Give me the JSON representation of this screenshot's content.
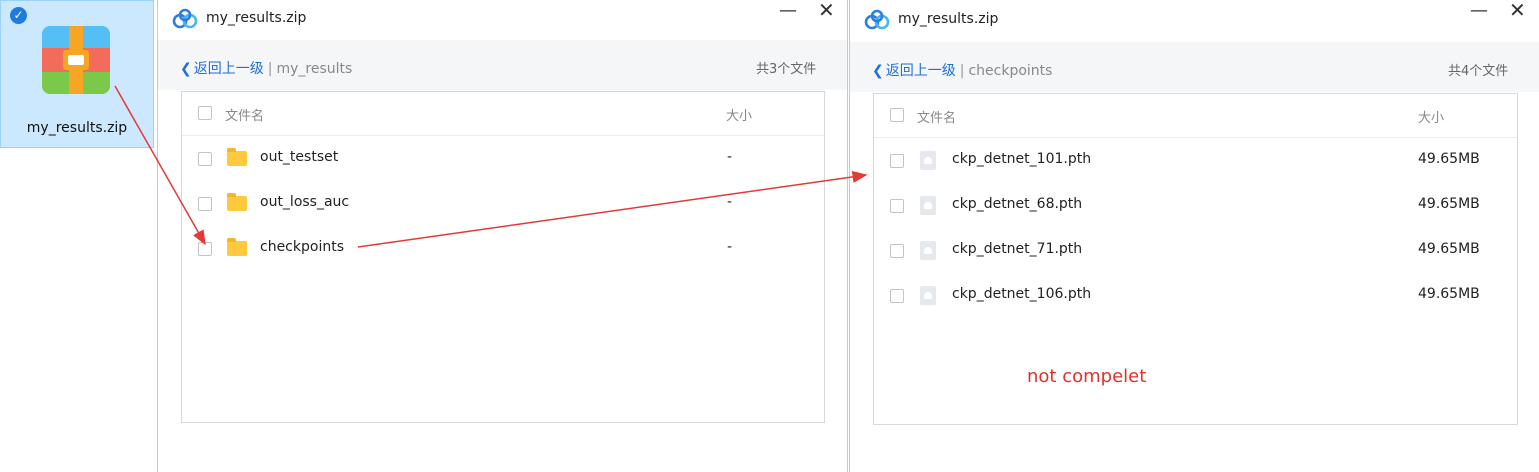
{
  "desktop": {
    "zip_label": "my_results.zip",
    "icon": "zip-archive-icon",
    "selected_icon": "checkmark-icon"
  },
  "window1": {
    "title": "my_results.zip",
    "back_label": "返回上一级",
    "separator": "|",
    "current_folder": "my_results",
    "file_count": "共3个文件",
    "header_name": "文件名",
    "header_size": "大小",
    "rows": [
      {
        "name": "out_testset",
        "size": "-",
        "icon": "folder-icon"
      },
      {
        "name": "out_loss_auc",
        "size": "-",
        "icon": "folder-icon"
      },
      {
        "name": "checkpoints",
        "size": "-",
        "icon": "folder-icon"
      }
    ]
  },
  "window2": {
    "title": "my_results.zip",
    "back_label": "返回上一级",
    "separator": "|",
    "current_folder": "checkpoints",
    "file_count": "共4个文件",
    "header_name": "文件名",
    "header_size": "大小",
    "rows": [
      {
        "name": "ckp_detnet_101.pth",
        "size": "49.65MB",
        "icon": "file-icon"
      },
      {
        "name": "ckp_detnet_68.pth",
        "size": "49.65MB",
        "icon": "file-icon"
      },
      {
        "name": "ckp_detnet_71.pth",
        "size": "49.65MB",
        "icon": "file-icon"
      },
      {
        "name": "ckp_detnet_106.pth",
        "size": "49.65MB",
        "icon": "file-icon"
      }
    ]
  },
  "window_controls": {
    "minimize": "—",
    "close": "✕"
  },
  "annotation": {
    "note": "not compelet",
    "color": "#e0322b"
  }
}
